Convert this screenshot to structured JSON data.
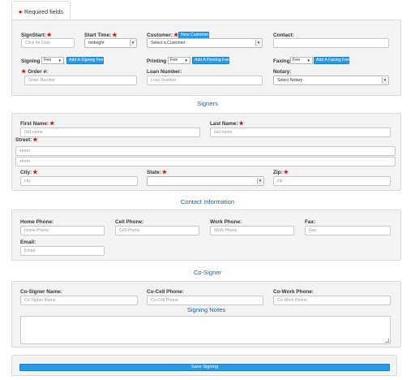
{
  "required_tab": {
    "label": "Required fields"
  },
  "signing": {
    "signstart_label": "SignStart:",
    "signstart_placeholder": "Click for Date",
    "starttime_label": "Start Time:",
    "starttime_value": "midnight",
    "customer_label": "Customer:",
    "new_customer_button": "New Customer",
    "customer_value": "Select a Customer",
    "contact_label": "Contact:",
    "signing_label": "Signing",
    "signing_fee_value": "Fee",
    "signing_fee_button": "Add A Signing Fee",
    "printing_label": "Printing",
    "printing_fee_value": "Fee",
    "printing_fee_button": "Add A Printing Fee",
    "faxing_label": "Faxing",
    "faxing_fee_value": "Fee",
    "faxing_fee_button": "Add A Faxing Fee",
    "order_label": "Order #:",
    "order_placeholder": "Order Number",
    "loan_label": "Loan Number:",
    "loan_placeholder": "Loan Number",
    "notary_label": "Notary:",
    "notary_value": "Select Notary"
  },
  "signers": {
    "heading": "Signers",
    "first_name_label": "First Name:",
    "first_name_placeholder": "first name",
    "last_name_label": "Last Name:",
    "last_name_placeholder": "last name",
    "street_label": "Street:",
    "street1_placeholder": "street",
    "street2_placeholder": "street",
    "city_label": "City:",
    "city_placeholder": "city",
    "state_label": "State:",
    "state_value": "",
    "zip_label": "Zip:",
    "zip_placeholder": "zip"
  },
  "contact": {
    "heading": "Contact Information",
    "home_label": "Home Phone:",
    "home_placeholder": "Home Phone",
    "cell_label": "Cell Phone:",
    "cell_placeholder": "Cell Phone",
    "work_label": "Work Phone:",
    "work_placeholder": "Work Phone",
    "fax_label": "Fax:",
    "fax_placeholder": "Fax",
    "email_label": "Email:",
    "email_placeholder": "Email"
  },
  "cosigner": {
    "heading": "Co-Signer",
    "name_label": "Co-Signer Name:",
    "name_placeholder": "Co-Signer Name",
    "cell_label": "Co-Cell Phone:",
    "cell_placeholder": "Co-Cell Phone",
    "work_label": "Co-Work Phone:",
    "work_placeholder": "Co-Work Phone",
    "notes_heading": "Signing Notes"
  },
  "footer": {
    "save_button": "Save Signing"
  },
  "colors": {
    "accent": "#2b9ae3",
    "required_star": "#cc1111",
    "heading": "#1f5f8f",
    "panel_bg": "#f3f3f3"
  },
  "icons": {
    "required": "star-icon",
    "dropdown": "chevron-down-icon"
  }
}
